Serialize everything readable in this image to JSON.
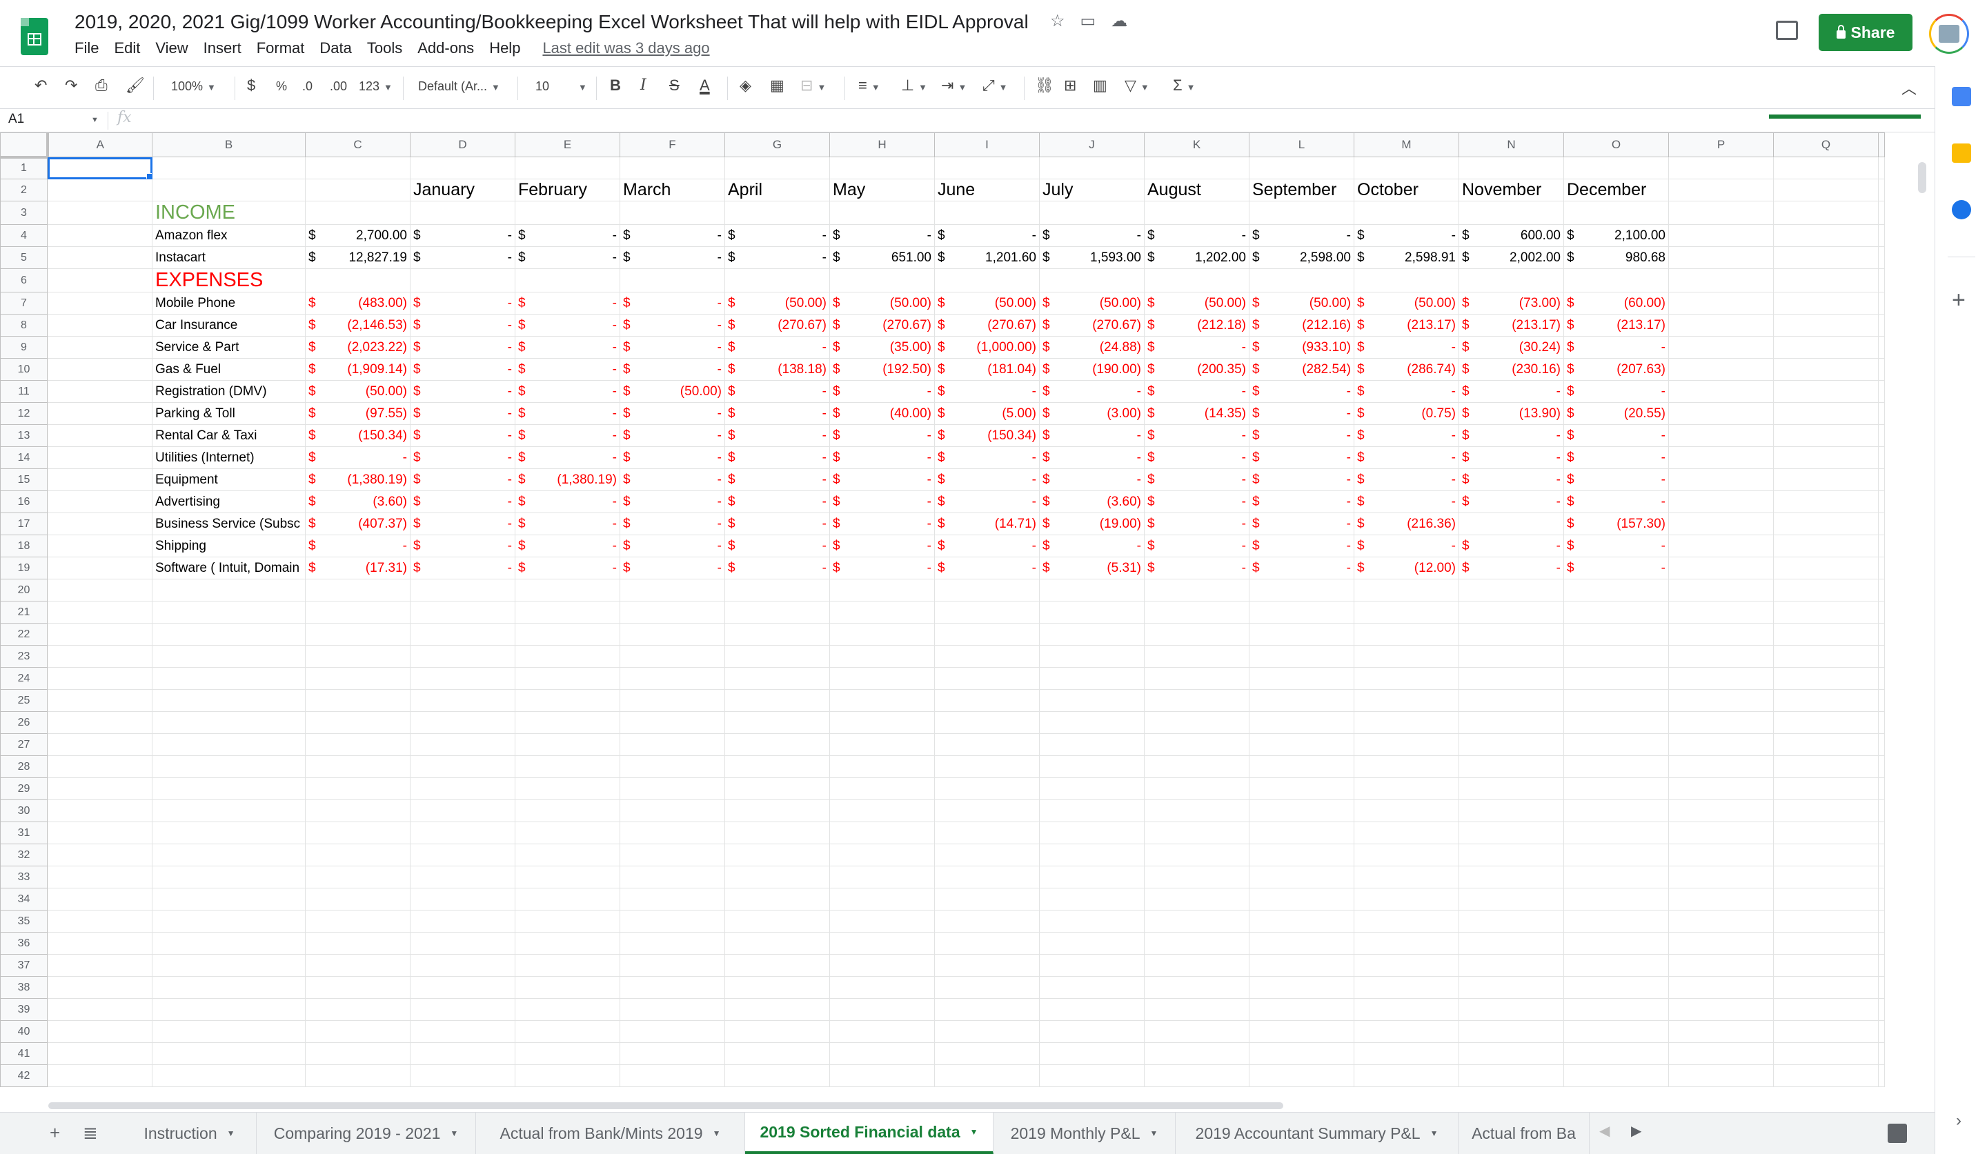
{
  "doc": {
    "title": "2019, 2020, 2021 Gig/1099 Worker Accounting/Bookkeeping Excel Worksheet That will help with EIDL Approval",
    "last_edit": "Last edit was 3 days ago",
    "share_label": "Share"
  },
  "menu": [
    "File",
    "Edit",
    "View",
    "Insert",
    "Format",
    "Data",
    "Tools",
    "Add-ons",
    "Help"
  ],
  "toolbar": {
    "zoom": "100%",
    "currency": "$",
    "percent": "%",
    "dec_decrease": ".0",
    "dec_increase": ".00",
    "more_formats": "123",
    "font": "Default (Ar...",
    "font_size": "10",
    "bold": "B",
    "italic": "I",
    "strike": "S",
    "text_color": "A",
    "functions": "Σ"
  },
  "formula_bar": {
    "cell_ref": "A1",
    "fx": "fx",
    "value": ""
  },
  "columns": [
    "A",
    "B",
    "C",
    "D",
    "E",
    "F",
    "G",
    "H",
    "I",
    "J",
    "K",
    "L",
    "M",
    "N",
    "O",
    "P",
    "Q"
  ],
  "row_numbers": [
    "1",
    "2",
    "3",
    "4",
    "5",
    "6",
    "7",
    "8",
    "9",
    "10",
    "11",
    "12",
    "13",
    "14",
    "15",
    "16",
    "17",
    "18",
    "19",
    "20",
    "21",
    "22",
    "23",
    "24",
    "25",
    "26",
    "27",
    "28",
    "29",
    "30",
    "31",
    "32",
    "33",
    "34",
    "35",
    "36",
    "37",
    "38",
    "39",
    "40",
    "41",
    "42"
  ],
  "months": [
    "January",
    "February",
    "March",
    "April",
    "May",
    "June",
    "July",
    "August",
    "September",
    "October",
    "November",
    "December"
  ],
  "income_label": "INCOME",
  "expenses_label": "EXPENSES",
  "currency_symbol": "$",
  "income_rows": [
    {
      "label": "Amazon flex",
      "total": "2,700.00",
      "months": [
        "-",
        "-",
        "-",
        "-",
        "-",
        "-",
        "-",
        "-",
        "-",
        "-",
        "600.00",
        "2,100.00"
      ]
    },
    {
      "label": "Instacart",
      "total": "12,827.19",
      "months": [
        "-",
        "-",
        "-",
        "-",
        "651.00",
        "1,201.60",
        "1,593.00",
        "1,202.00",
        "2,598.00",
        "2,598.91",
        "2,002.00",
        "980.68"
      ]
    }
  ],
  "expense_rows": [
    {
      "label": "Mobile Phone",
      "total": "(483.00)",
      "months": [
        "-",
        "-",
        "-",
        "(50.00)",
        "(50.00)",
        "(50.00)",
        "(50.00)",
        "(50.00)",
        "(50.00)",
        "(50.00)",
        "(73.00)",
        "(60.00)"
      ]
    },
    {
      "label": "Car Insurance",
      "total": "(2,146.53)",
      "months": [
        "-",
        "-",
        "-",
        "(270.67)",
        "(270.67)",
        "(270.67)",
        "(270.67)",
        "(212.18)",
        "(212.16)",
        "(213.17)",
        "(213.17)",
        "(213.17)"
      ]
    },
    {
      "label": "Service & Part",
      "total": "(2,023.22)",
      "months": [
        "-",
        "-",
        "-",
        "-",
        "(35.00)",
        "(1,000.00)",
        "(24.88)",
        "-",
        "(933.10)",
        "-",
        "(30.24)",
        "-"
      ]
    },
    {
      "label": "Gas & Fuel",
      "total": "(1,909.14)",
      "months": [
        "-",
        "-",
        "-",
        "(138.18)",
        "(192.50)",
        "(181.04)",
        "(190.00)",
        "(200.35)",
        "(282.54)",
        "(286.74)",
        "(230.16)",
        "(207.63)"
      ]
    },
    {
      "label": "Registration (DMV)",
      "total": "(50.00)",
      "months": [
        "-",
        "-",
        "(50.00)",
        "-",
        "-",
        "-",
        "-",
        "-",
        "-",
        "-",
        "-",
        "-"
      ]
    },
    {
      "label": "Parking & Toll",
      "total": "(97.55)",
      "months": [
        "-",
        "-",
        "-",
        "-",
        "(40.00)",
        "(5.00)",
        "(3.00)",
        "(14.35)",
        "-",
        "(0.75)",
        "(13.90)",
        "(20.55)"
      ]
    },
    {
      "label": "Rental Car & Taxi",
      "total": "(150.34)",
      "months": [
        "-",
        "-",
        "-",
        "-",
        "-",
        "(150.34)",
        "-",
        "-",
        "-",
        "-",
        "-",
        "-"
      ]
    },
    {
      "label": "Utilities (Internet)",
      "total": "-",
      "months": [
        "-",
        "-",
        "-",
        "-",
        "-",
        "-",
        "-",
        "-",
        "-",
        "-",
        "-",
        "-"
      ]
    },
    {
      "label": "Equipment",
      "total": "(1,380.19)",
      "months": [
        "-",
        "(1,380.19)",
        "-",
        "-",
        "-",
        "-",
        "-",
        "-",
        "-",
        "-",
        "-",
        "-"
      ]
    },
    {
      "label": "Advertising",
      "total": "(3.60)",
      "months": [
        "-",
        "-",
        "-",
        "-",
        "-",
        "-",
        "(3.60)",
        "-",
        "-",
        "-",
        "-",
        "-"
      ]
    },
    {
      "label": "Business Service (Subsc",
      "total": "(407.37)",
      "months": [
        "-",
        "-",
        "-",
        "-",
        "-",
        "(14.71)",
        "(19.00)",
        "-",
        "-",
        "(216.36)",
        "",
        "(157.30)"
      ]
    },
    {
      "label": "Shipping",
      "total": "-",
      "months": [
        "-",
        "-",
        "-",
        "-",
        "-",
        "-",
        "-",
        "-",
        "-",
        "-",
        "-",
        "-"
      ]
    },
    {
      "label": "Software ( Intuit, Domain",
      "total": "(17.31)",
      "months": [
        "-",
        "-",
        "-",
        "-",
        "-",
        "-",
        "(5.31)",
        "-",
        "-",
        "(12.00)",
        "-",
        "-"
      ]
    }
  ],
  "sheet_tabs": [
    {
      "label": "Instruction",
      "active": false
    },
    {
      "label": "Comparing 2019 - 2021",
      "active": false
    },
    {
      "label": "Actual from Bank/Mints 2019",
      "active": false
    },
    {
      "label": "2019 Sorted Financial data",
      "active": true
    },
    {
      "label": "2019 Monthly P&L",
      "active": false
    },
    {
      "label": "2019 Accountant Summary P&L",
      "active": false
    },
    {
      "label": "Actual from Ba",
      "active": false
    }
  ],
  "colors": {
    "income": "#6aa84f",
    "expense": "#ff0000",
    "share": "#1e8e3e",
    "active_tab": "#188038",
    "selection": "#1a73e8"
  },
  "side_panel_icons": [
    "calendar-icon",
    "keep-icon",
    "tasks-icon",
    "plus-icon"
  ]
}
